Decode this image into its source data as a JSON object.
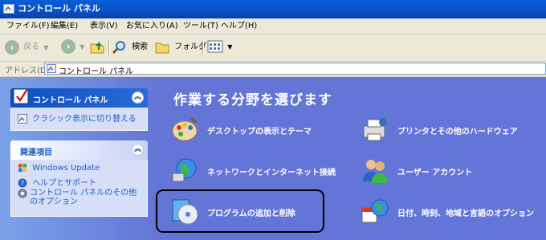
{
  "window": {
    "title": "コントロール パネル"
  },
  "menu": [
    "ファイル(F)",
    "編集(E)",
    "表示(V)",
    "お気に入り(A)",
    "ツール(T)",
    "ヘルプ(H)"
  ],
  "toolbar": {
    "back": "戻る",
    "search": "検索",
    "folders": "フォルダ"
  },
  "address": {
    "label": "アドレス(D)",
    "value": "コントロール パネル"
  },
  "left": {
    "panel1": {
      "title": "コントロール パネル",
      "links": [
        "クラシック表示に切り替える"
      ]
    },
    "panel2": {
      "title": "関連項目",
      "links": [
        "Windows Update",
        "ヘルプとサポート",
        "コントロール パネルのその他のオプション"
      ]
    }
  },
  "main": {
    "title": "作業する分野を選びます",
    "categories": [
      "デスクトップの表示とテーマ",
      "プリンタとその他のハードウェア",
      "ネットワークとインターネット接続",
      "ユーザー アカウント",
      "プログラムの追加と削除",
      "日付、時刻、地域と言語のオプション"
    ]
  },
  "colors": {
    "titlebar": "#0a5fd8",
    "pane": "#6375d6",
    "link": "#215dc6",
    "panel_header": "#215dc6"
  }
}
